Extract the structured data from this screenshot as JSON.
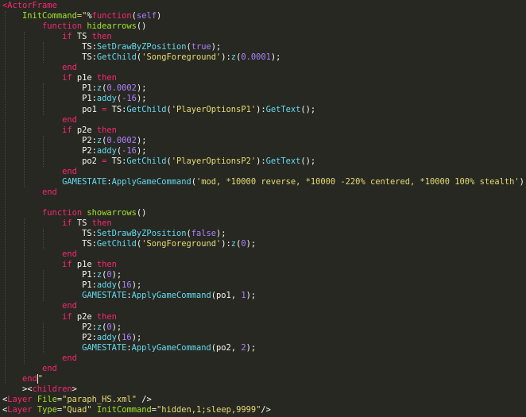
{
  "colors": {
    "background": "#272822",
    "tag": "#f92672",
    "attribute": "#a6e22e",
    "string": "#e6db74",
    "keyword": "#f92672",
    "function": "#66d9ef",
    "number": "#ae81ff",
    "plain": "#f8f8f2"
  },
  "editor": {
    "lines": [
      [
        [
          "<",
          "tag"
        ],
        [
          "ActorFrame",
          "tag"
        ]
      ],
      [
        [
          "    InitCommand",
          "attr"
        ],
        [
          "=\"",
          "str"
        ],
        [
          "%",
          "plain"
        ],
        [
          "function",
          "kw"
        ],
        [
          "(",
          "plain"
        ],
        [
          "self",
          "sup"
        ],
        [
          ")",
          "plain"
        ]
      ],
      [
        [
          "        function ",
          "kw"
        ],
        [
          "hidearrows",
          "attr"
        ],
        [
          "()",
          "plain"
        ]
      ],
      [
        [
          "            if ",
          "kw"
        ],
        [
          "TS ",
          "plain"
        ],
        [
          "then",
          "kw"
        ]
      ],
      [
        [
          "                TS",
          "plain"
        ],
        [
          ":",
          "plain"
        ],
        [
          "SetDrawByZPosition",
          "fn"
        ],
        [
          "(",
          "plain"
        ],
        [
          "true",
          "num"
        ],
        [
          ");",
          "plain"
        ]
      ],
      [
        [
          "                TS",
          "plain"
        ],
        [
          ":",
          "plain"
        ],
        [
          "GetChild",
          "fn"
        ],
        [
          "(",
          "plain"
        ],
        [
          "'SongForeground'",
          "str"
        ],
        [
          "):",
          "plain"
        ],
        [
          "z",
          "fn"
        ],
        [
          "(",
          "plain"
        ],
        [
          "0.0001",
          "num"
        ],
        [
          ");",
          "plain"
        ]
      ],
      [
        [
          "            end",
          "kw"
        ]
      ],
      [
        [
          "            if ",
          "kw"
        ],
        [
          "p1e ",
          "plain"
        ],
        [
          "then",
          "kw"
        ]
      ],
      [
        [
          "                P1",
          "plain"
        ],
        [
          ":",
          "plain"
        ],
        [
          "z",
          "fn"
        ],
        [
          "(",
          "plain"
        ],
        [
          "0.0002",
          "num"
        ],
        [
          ");",
          "plain"
        ]
      ],
      [
        [
          "                P1",
          "plain"
        ],
        [
          ":",
          "plain"
        ],
        [
          "addy",
          "fn"
        ],
        [
          "(",
          "plain"
        ],
        [
          "-16",
          "num"
        ],
        [
          ");",
          "plain"
        ]
      ],
      [
        [
          "                po1 ",
          "plain"
        ],
        [
          "= ",
          "kw"
        ],
        [
          "TS",
          "plain"
        ],
        [
          ":",
          "plain"
        ],
        [
          "GetChild",
          "fn"
        ],
        [
          "(",
          "plain"
        ],
        [
          "'PlayerOptionsP1'",
          "str"
        ],
        [
          "):",
          "plain"
        ],
        [
          "GetText",
          "fn"
        ],
        [
          "();",
          "plain"
        ]
      ],
      [
        [
          "            end",
          "kw"
        ]
      ],
      [
        [
          "            if ",
          "kw"
        ],
        [
          "p2e ",
          "plain"
        ],
        [
          "then",
          "kw"
        ]
      ],
      [
        [
          "                P2",
          "plain"
        ],
        [
          ":",
          "plain"
        ],
        [
          "z",
          "fn"
        ],
        [
          "(",
          "plain"
        ],
        [
          "0.0002",
          "num"
        ],
        [
          ");",
          "plain"
        ]
      ],
      [
        [
          "                P2",
          "plain"
        ],
        [
          ":",
          "plain"
        ],
        [
          "addy",
          "fn"
        ],
        [
          "(",
          "plain"
        ],
        [
          "-16",
          "num"
        ],
        [
          ");",
          "plain"
        ]
      ],
      [
        [
          "                po2 ",
          "plain"
        ],
        [
          "= ",
          "kw"
        ],
        [
          "TS",
          "plain"
        ],
        [
          ":",
          "plain"
        ],
        [
          "GetChild",
          "fn"
        ],
        [
          "(",
          "plain"
        ],
        [
          "'PlayerOptionsP2'",
          "str"
        ],
        [
          "):",
          "plain"
        ],
        [
          "GetText",
          "fn"
        ],
        [
          "();",
          "plain"
        ]
      ],
      [
        [
          "            end",
          "kw"
        ]
      ],
      [
        [
          "            GAMESTATE",
          "fn"
        ],
        [
          ":",
          "plain"
        ],
        [
          "ApplyGameCommand",
          "fn"
        ],
        [
          "(",
          "plain"
        ],
        [
          "'mod, *10000 reverse, *10000 -220% centered, *10000 100% stealth'",
          "str"
        ],
        [
          ");",
          "plain"
        ]
      ],
      [
        [
          "        end",
          "kw"
        ]
      ],
      [
        [
          "",
          "plain"
        ]
      ],
      [
        [
          "        function ",
          "kw"
        ],
        [
          "showarrows",
          "attr"
        ],
        [
          "()",
          "plain"
        ]
      ],
      [
        [
          "            if ",
          "kw"
        ],
        [
          "TS ",
          "plain"
        ],
        [
          "then",
          "kw"
        ]
      ],
      [
        [
          "                TS",
          "plain"
        ],
        [
          ":",
          "plain"
        ],
        [
          "SetDrawByZPosition",
          "fn"
        ],
        [
          "(",
          "plain"
        ],
        [
          "false",
          "num"
        ],
        [
          ");",
          "plain"
        ]
      ],
      [
        [
          "                TS",
          "plain"
        ],
        [
          ":",
          "plain"
        ],
        [
          "GetChild",
          "fn"
        ],
        [
          "(",
          "plain"
        ],
        [
          "'SongForeground'",
          "str"
        ],
        [
          "):",
          "plain"
        ],
        [
          "z",
          "fn"
        ],
        [
          "(",
          "plain"
        ],
        [
          "0",
          "num"
        ],
        [
          ");",
          "plain"
        ]
      ],
      [
        [
          "            end",
          "kw"
        ]
      ],
      [
        [
          "            if ",
          "kw"
        ],
        [
          "p1e ",
          "plain"
        ],
        [
          "then",
          "kw"
        ]
      ],
      [
        [
          "                P1",
          "plain"
        ],
        [
          ":",
          "plain"
        ],
        [
          "z",
          "fn"
        ],
        [
          "(",
          "plain"
        ],
        [
          "0",
          "num"
        ],
        [
          ");",
          "plain"
        ]
      ],
      [
        [
          "                P1",
          "plain"
        ],
        [
          ":",
          "plain"
        ],
        [
          "addy",
          "fn"
        ],
        [
          "(",
          "plain"
        ],
        [
          "16",
          "num"
        ],
        [
          ");",
          "plain"
        ]
      ],
      [
        [
          "                GAMESTATE",
          "fn"
        ],
        [
          ":",
          "plain"
        ],
        [
          "ApplyGameCommand",
          "fn"
        ],
        [
          "(",
          "plain"
        ],
        [
          "po1",
          "plain"
        ],
        [
          ", ",
          "plain"
        ],
        [
          "1",
          "num"
        ],
        [
          ");",
          "plain"
        ]
      ],
      [
        [
          "            end",
          "kw"
        ]
      ],
      [
        [
          "            if ",
          "kw"
        ],
        [
          "p2e ",
          "plain"
        ],
        [
          "then",
          "kw"
        ]
      ],
      [
        [
          "                P2",
          "plain"
        ],
        [
          ":",
          "plain"
        ],
        [
          "z",
          "fn"
        ],
        [
          "(",
          "plain"
        ],
        [
          "0",
          "num"
        ],
        [
          ");",
          "plain"
        ]
      ],
      [
        [
          "                P2",
          "plain"
        ],
        [
          ":",
          "plain"
        ],
        [
          "addy",
          "fn"
        ],
        [
          "(",
          "plain"
        ],
        [
          "16",
          "num"
        ],
        [
          ");",
          "plain"
        ]
      ],
      [
        [
          "                GAMESTATE",
          "fn"
        ],
        [
          ":",
          "plain"
        ],
        [
          "ApplyGameCommand",
          "fn"
        ],
        [
          "(",
          "plain"
        ],
        [
          "po2",
          "plain"
        ],
        [
          ", ",
          "plain"
        ],
        [
          "2",
          "num"
        ],
        [
          ");",
          "plain"
        ]
      ],
      [
        [
          "            end",
          "kw"
        ]
      ],
      [
        [
          "        end",
          "kw"
        ]
      ],
      [
        [
          "    end",
          "kw"
        ],
        [
          "|",
          "cursor"
        ],
        [
          "\"",
          "str"
        ]
      ],
      [
        [
          "    ><",
          "plain"
        ],
        [
          "children",
          "tag"
        ],
        [
          ">",
          "plain"
        ]
      ],
      [
        [
          "<",
          "plain"
        ],
        [
          "Layer ",
          "tag"
        ],
        [
          "File",
          "attr"
        ],
        [
          "=",
          "plain"
        ],
        [
          "\"paraph_HS.xml\"",
          "str"
        ],
        [
          " />",
          "plain"
        ]
      ],
      [
        [
          "<",
          "plain"
        ],
        [
          "Layer ",
          "tag"
        ],
        [
          "Type",
          "attr"
        ],
        [
          "=",
          "plain"
        ],
        [
          "\"Quad\"",
          "str"
        ],
        [
          " ",
          "plain"
        ],
        [
          "InitCommand",
          "attr"
        ],
        [
          "=",
          "plain"
        ],
        [
          "\"hidden,1;sleep,9999\"",
          "str"
        ],
        [
          "/>",
          "plain"
        ]
      ]
    ]
  }
}
